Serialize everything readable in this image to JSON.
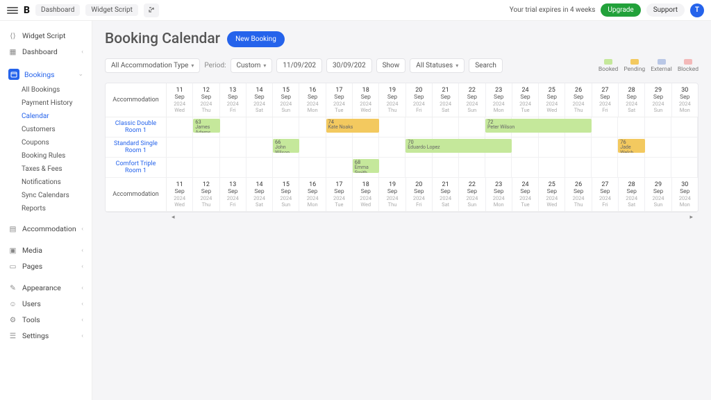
{
  "topbar": {
    "breadcrumb1": "Dashboard",
    "breadcrumb2": "Widget Script",
    "trial_text": "Your trial expires in 4 weeks",
    "upgrade": "Upgrade",
    "support": "Support",
    "avatar_initial": "T"
  },
  "sidebar": {
    "widget_script": "Widget Script",
    "dashboard": "Dashboard",
    "bookings": "Bookings",
    "sub": {
      "all_bookings": "All Bookings",
      "payment_history": "Payment History",
      "calendar": "Calendar",
      "customers": "Customers",
      "coupons": "Coupons",
      "booking_rules": "Booking Rules",
      "taxes_fees": "Taxes & Fees",
      "notifications": "Notifications",
      "sync_calendars": "Sync Calendars",
      "reports": "Reports"
    },
    "accommodation": "Accommodation",
    "media": "Media",
    "pages": "Pages",
    "appearance": "Appearance",
    "users": "Users",
    "tools": "Tools",
    "settings": "Settings"
  },
  "page": {
    "title": "Booking Calendar",
    "new_booking": "New Booking"
  },
  "filters": {
    "acc_type": "All Accommodation Type",
    "period_label": "Period:",
    "period_value": "Custom",
    "date_from": "11/09/202",
    "date_to": "30/09/202",
    "show": "Show",
    "status": "All Statuses",
    "search": "Search"
  },
  "legend": {
    "booked": "Booked",
    "pending": "Pending",
    "external": "External",
    "blocked": "Blocked",
    "colors": {
      "booked": "#c5e89b",
      "pending": "#f3c95f",
      "external": "#b9c7e6",
      "blocked": "#f3b9b9"
    }
  },
  "calendar": {
    "acc_header": "Accommodation",
    "days": [
      {
        "num": "11",
        "mon": "Sep",
        "yr": "2024",
        "dow": "Wed"
      },
      {
        "num": "12",
        "mon": "Sep",
        "yr": "2024",
        "dow": "Thu"
      },
      {
        "num": "13",
        "mon": "Sep",
        "yr": "2024",
        "dow": "Fri"
      },
      {
        "num": "14",
        "mon": "Sep",
        "yr": "2024",
        "dow": "Sat"
      },
      {
        "num": "15",
        "mon": "Sep",
        "yr": "2024",
        "dow": "Sun"
      },
      {
        "num": "16",
        "mon": "Sep",
        "yr": "2024",
        "dow": "Mon"
      },
      {
        "num": "17",
        "mon": "Sep",
        "yr": "2024",
        "dow": "Tue"
      },
      {
        "num": "18",
        "mon": "Sep",
        "yr": "2024",
        "dow": "Wed"
      },
      {
        "num": "19",
        "mon": "Sep",
        "yr": "2024",
        "dow": "Thu"
      },
      {
        "num": "20",
        "mon": "Sep",
        "yr": "2024",
        "dow": "Fri"
      },
      {
        "num": "21",
        "mon": "Sep",
        "yr": "2024",
        "dow": "Sat"
      },
      {
        "num": "22",
        "mon": "Sep",
        "yr": "2024",
        "dow": "Sun"
      },
      {
        "num": "23",
        "mon": "Sep",
        "yr": "2024",
        "dow": "Mon"
      },
      {
        "num": "24",
        "mon": "Sep",
        "yr": "2024",
        "dow": "Tue"
      },
      {
        "num": "25",
        "mon": "Sep",
        "yr": "2024",
        "dow": "Wed"
      },
      {
        "num": "26",
        "mon": "Sep",
        "yr": "2024",
        "dow": "Thu"
      },
      {
        "num": "27",
        "mon": "Sep",
        "yr": "2024",
        "dow": "Fri"
      },
      {
        "num": "28",
        "mon": "Sep",
        "yr": "2024",
        "dow": "Sat"
      },
      {
        "num": "29",
        "mon": "Sep",
        "yr": "2024",
        "dow": "Sun"
      },
      {
        "num": "30",
        "mon": "Sep",
        "yr": "2024",
        "dow": "Mon"
      }
    ],
    "rooms": [
      {
        "name": "Classic Double Room 1",
        "bookings": [
          {
            "id": "63",
            "guest": "James Adams",
            "start": 1,
            "span": 1,
            "status": "booked"
          },
          {
            "id": "74",
            "guest": "Kate Noaks",
            "start": 6,
            "span": 2,
            "status": "pending"
          },
          {
            "id": "72",
            "guest": "Peter Wilson",
            "start": 12,
            "span": 4,
            "status": "booked"
          }
        ]
      },
      {
        "name": "Standard Single Room 1",
        "bookings": [
          {
            "id": "66",
            "guest": "John Wilson",
            "start": 4,
            "span": 1,
            "status": "booked"
          },
          {
            "id": "70",
            "guest": "Eduardo Lopez",
            "start": 9,
            "span": 4,
            "status": "booked"
          },
          {
            "id": "76",
            "guest": "Jade Welch",
            "start": 17,
            "span": 1,
            "status": "pending"
          }
        ]
      },
      {
        "name": "Comfort Triple Room 1",
        "bookings": [
          {
            "id": "68",
            "guest": "Emma Smith",
            "start": 7,
            "span": 1,
            "status": "booked"
          }
        ]
      }
    ]
  }
}
